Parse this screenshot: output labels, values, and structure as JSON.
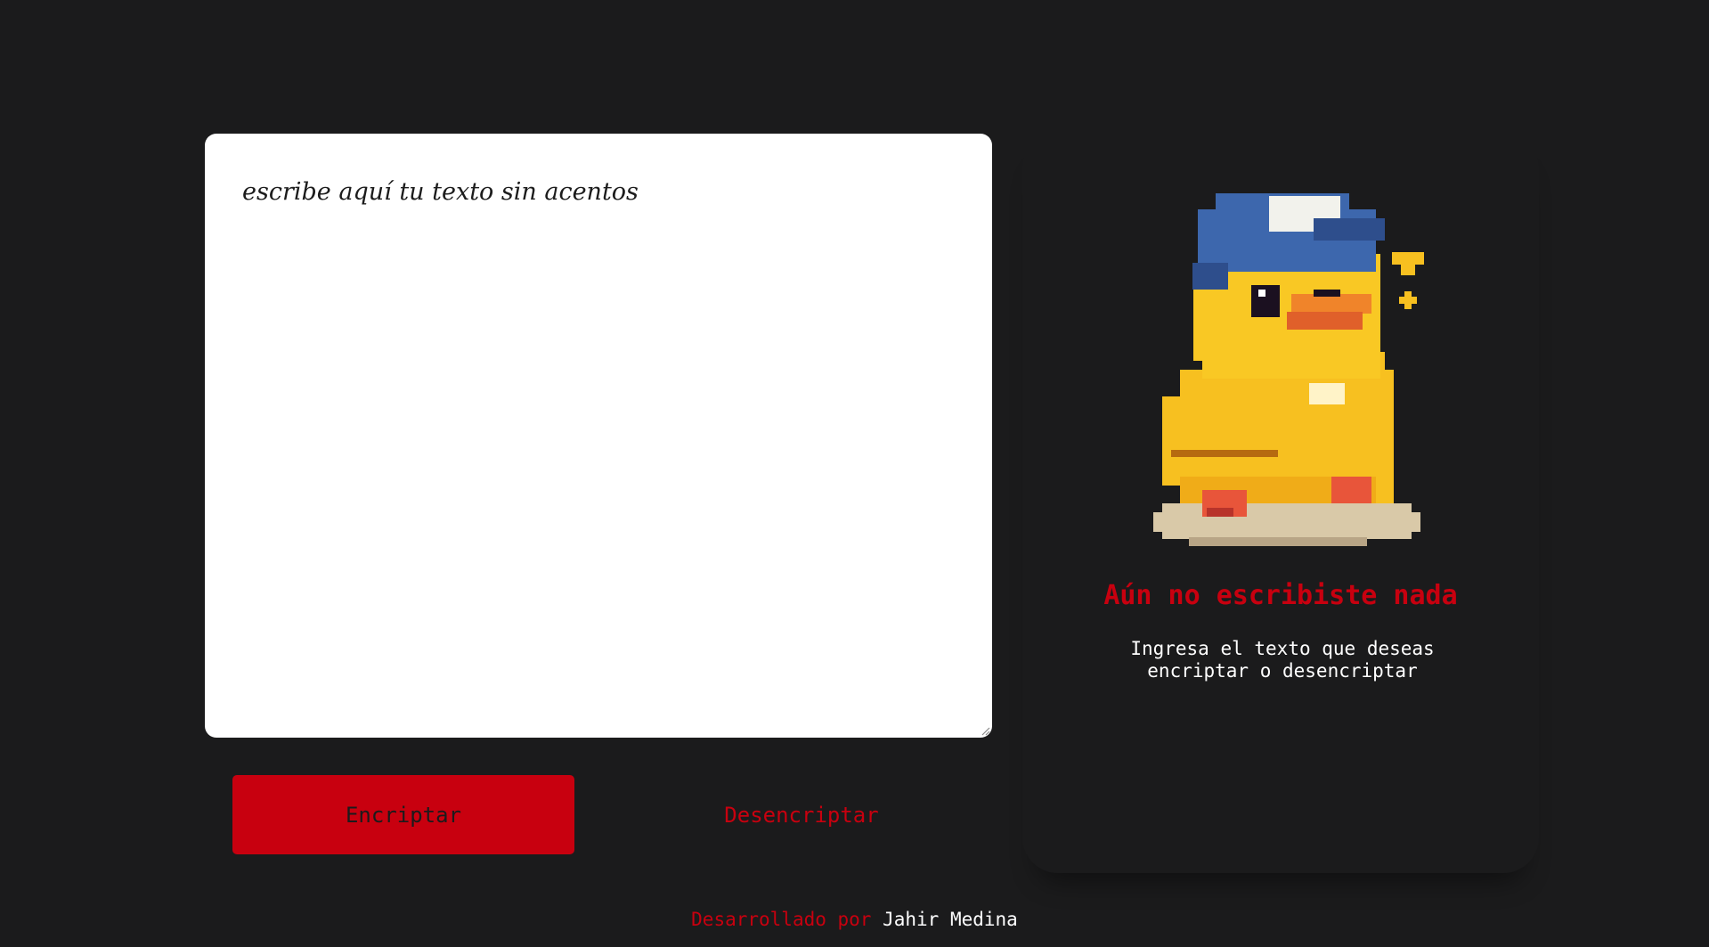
{
  "editor": {
    "placeholder": "escribe aquí tu texto sin acentos"
  },
  "buttons": {
    "encrypt_label": "Encriptar",
    "decrypt_label": "Desencriptar"
  },
  "output": {
    "image_icon": "pixel-duck-with-cap-icon",
    "title": "Aún no escribiste nada",
    "message": "Ingresa el texto que deseas encriptar o desencriptar"
  },
  "footer": {
    "prefix": "Desarrollado por",
    "author": "Jahir Medina"
  },
  "colors": {
    "background": "#1b1b1c",
    "accent": "#c8000f",
    "text_light": "#ffffff"
  }
}
